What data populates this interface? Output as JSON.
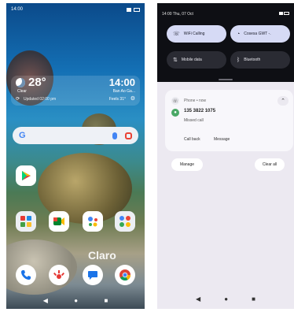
{
  "left_phone": {
    "status": {
      "time": "14:00"
    },
    "weather": {
      "temperature": "28°",
      "condition": "Clear",
      "time": "14:00",
      "date": "Ban Ao Ga...",
      "updated": "Updated 02:00 pm",
      "extra": "Feels 31°"
    },
    "carrier_watermark": "Claro",
    "nav": {
      "back": "◀",
      "home": "●",
      "recents": "■"
    }
  },
  "right_phone": {
    "status": {
      "datetime": "14:00 Thu, 07 Oct"
    },
    "tiles": {
      "wifi_calling": "WiFi Calling",
      "network": "Cosesa GWT -.",
      "mobile_data": "Mobile data",
      "bluetooth": "Bluetooth"
    },
    "notification": {
      "app": "Phone • now",
      "number": "135 3822 1075",
      "status": "Missed call",
      "call_back": "Call back",
      "message": "Message"
    },
    "manage_label": "Manage",
    "clear_all_label": "Clear all",
    "nav": {
      "back": "◀",
      "home": "●",
      "recents": "■"
    }
  },
  "colors": {
    "qs_dark": "#0e0f14",
    "tile_active": "#d6daf5",
    "shade_bg": "#ece9f1"
  }
}
